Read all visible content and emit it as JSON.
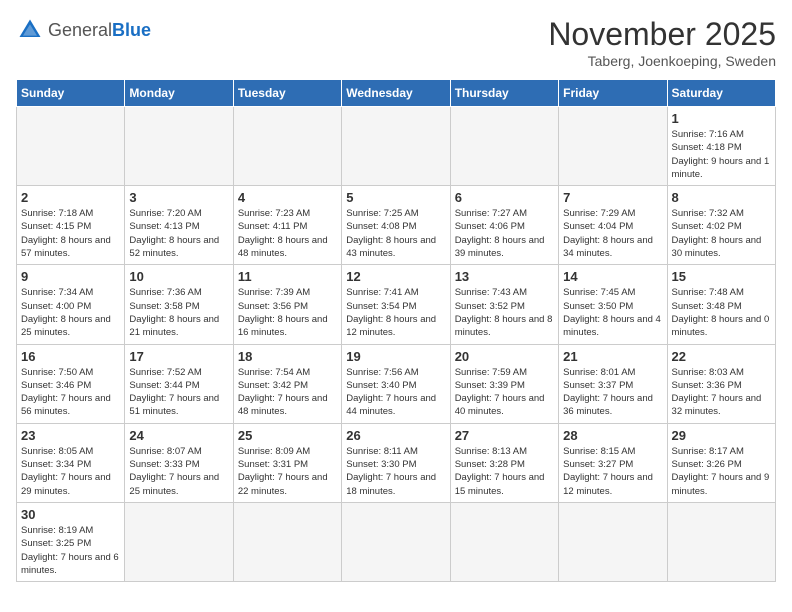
{
  "header": {
    "logo_general": "General",
    "logo_blue": "Blue",
    "month_title": "November 2025",
    "subtitle": "Taberg, Joenkoeping, Sweden"
  },
  "days_of_week": [
    "Sunday",
    "Monday",
    "Tuesday",
    "Wednesday",
    "Thursday",
    "Friday",
    "Saturday"
  ],
  "weeks": [
    [
      {
        "day": "",
        "info": ""
      },
      {
        "day": "",
        "info": ""
      },
      {
        "day": "",
        "info": ""
      },
      {
        "day": "",
        "info": ""
      },
      {
        "day": "",
        "info": ""
      },
      {
        "day": "",
        "info": ""
      },
      {
        "day": "1",
        "info": "Sunrise: 7:16 AM\nSunset: 4:18 PM\nDaylight: 9 hours and 1 minute."
      }
    ],
    [
      {
        "day": "2",
        "info": "Sunrise: 7:18 AM\nSunset: 4:15 PM\nDaylight: 8 hours and 57 minutes."
      },
      {
        "day": "3",
        "info": "Sunrise: 7:20 AM\nSunset: 4:13 PM\nDaylight: 8 hours and 52 minutes."
      },
      {
        "day": "4",
        "info": "Sunrise: 7:23 AM\nSunset: 4:11 PM\nDaylight: 8 hours and 48 minutes."
      },
      {
        "day": "5",
        "info": "Sunrise: 7:25 AM\nSunset: 4:08 PM\nDaylight: 8 hours and 43 minutes."
      },
      {
        "day": "6",
        "info": "Sunrise: 7:27 AM\nSunset: 4:06 PM\nDaylight: 8 hours and 39 minutes."
      },
      {
        "day": "7",
        "info": "Sunrise: 7:29 AM\nSunset: 4:04 PM\nDaylight: 8 hours and 34 minutes."
      },
      {
        "day": "8",
        "info": "Sunrise: 7:32 AM\nSunset: 4:02 PM\nDaylight: 8 hours and 30 minutes."
      }
    ],
    [
      {
        "day": "9",
        "info": "Sunrise: 7:34 AM\nSunset: 4:00 PM\nDaylight: 8 hours and 25 minutes."
      },
      {
        "day": "10",
        "info": "Sunrise: 7:36 AM\nSunset: 3:58 PM\nDaylight: 8 hours and 21 minutes."
      },
      {
        "day": "11",
        "info": "Sunrise: 7:39 AM\nSunset: 3:56 PM\nDaylight: 8 hours and 16 minutes."
      },
      {
        "day": "12",
        "info": "Sunrise: 7:41 AM\nSunset: 3:54 PM\nDaylight: 8 hours and 12 minutes."
      },
      {
        "day": "13",
        "info": "Sunrise: 7:43 AM\nSunset: 3:52 PM\nDaylight: 8 hours and 8 minutes."
      },
      {
        "day": "14",
        "info": "Sunrise: 7:45 AM\nSunset: 3:50 PM\nDaylight: 8 hours and 4 minutes."
      },
      {
        "day": "15",
        "info": "Sunrise: 7:48 AM\nSunset: 3:48 PM\nDaylight: 8 hours and 0 minutes."
      }
    ],
    [
      {
        "day": "16",
        "info": "Sunrise: 7:50 AM\nSunset: 3:46 PM\nDaylight: 7 hours and 56 minutes."
      },
      {
        "day": "17",
        "info": "Sunrise: 7:52 AM\nSunset: 3:44 PM\nDaylight: 7 hours and 51 minutes."
      },
      {
        "day": "18",
        "info": "Sunrise: 7:54 AM\nSunset: 3:42 PM\nDaylight: 7 hours and 48 minutes."
      },
      {
        "day": "19",
        "info": "Sunrise: 7:56 AM\nSunset: 3:40 PM\nDaylight: 7 hours and 44 minutes."
      },
      {
        "day": "20",
        "info": "Sunrise: 7:59 AM\nSunset: 3:39 PM\nDaylight: 7 hours and 40 minutes."
      },
      {
        "day": "21",
        "info": "Sunrise: 8:01 AM\nSunset: 3:37 PM\nDaylight: 7 hours and 36 minutes."
      },
      {
        "day": "22",
        "info": "Sunrise: 8:03 AM\nSunset: 3:36 PM\nDaylight: 7 hours and 32 minutes."
      }
    ],
    [
      {
        "day": "23",
        "info": "Sunrise: 8:05 AM\nSunset: 3:34 PM\nDaylight: 7 hours and 29 minutes."
      },
      {
        "day": "24",
        "info": "Sunrise: 8:07 AM\nSunset: 3:33 PM\nDaylight: 7 hours and 25 minutes."
      },
      {
        "day": "25",
        "info": "Sunrise: 8:09 AM\nSunset: 3:31 PM\nDaylight: 7 hours and 22 minutes."
      },
      {
        "day": "26",
        "info": "Sunrise: 8:11 AM\nSunset: 3:30 PM\nDaylight: 7 hours and 18 minutes."
      },
      {
        "day": "27",
        "info": "Sunrise: 8:13 AM\nSunset: 3:28 PM\nDaylight: 7 hours and 15 minutes."
      },
      {
        "day": "28",
        "info": "Sunrise: 8:15 AM\nSunset: 3:27 PM\nDaylight: 7 hours and 12 minutes."
      },
      {
        "day": "29",
        "info": "Sunrise: 8:17 AM\nSunset: 3:26 PM\nDaylight: 7 hours and 9 minutes."
      }
    ],
    [
      {
        "day": "30",
        "info": "Sunrise: 8:19 AM\nSunset: 3:25 PM\nDaylight: 7 hours and 6 minutes."
      },
      {
        "day": "",
        "info": ""
      },
      {
        "day": "",
        "info": ""
      },
      {
        "day": "",
        "info": ""
      },
      {
        "day": "",
        "info": ""
      },
      {
        "day": "",
        "info": ""
      },
      {
        "day": "",
        "info": ""
      }
    ]
  ]
}
